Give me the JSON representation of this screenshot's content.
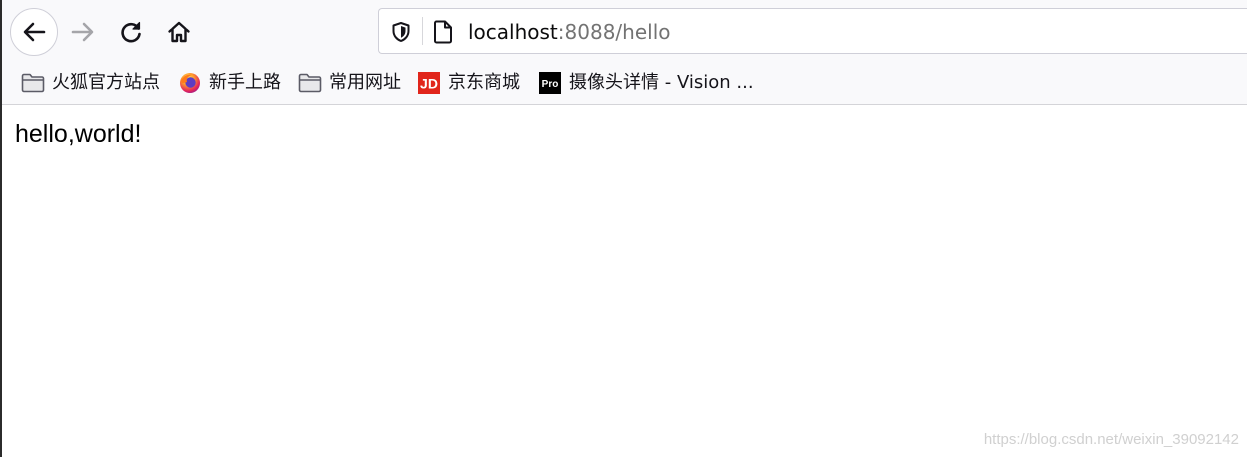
{
  "toolbar": {
    "back_icon": "arrow-left-icon",
    "forward_icon": "arrow-right-icon",
    "reload_icon": "reload-icon",
    "home_icon": "home-icon"
  },
  "urlbar": {
    "host": "localhost",
    "rest": ":8088/hello",
    "shield_icon": "shield-icon",
    "page_icon": "page-icon"
  },
  "bookmarks": [
    {
      "label": "火狐官方站点",
      "icon": "folder-icon"
    },
    {
      "label": "新手上路",
      "icon": "firefox-icon"
    },
    {
      "label": "常用网址",
      "icon": "folder-icon"
    },
    {
      "label": "京东商城",
      "icon": "jd-icon",
      "icon_text": "JD"
    },
    {
      "label": "摄像头详情 - Vision ...",
      "icon": "pro-icon",
      "icon_text": "Pro"
    }
  ],
  "page": {
    "body_text": "hello,world!"
  },
  "watermark": "https://blog.csdn.net/weixin_39092142",
  "colors": {
    "toolbar_bg": "#f9f9fb",
    "jd_red": "#e1251b",
    "pro_black": "#000000"
  }
}
